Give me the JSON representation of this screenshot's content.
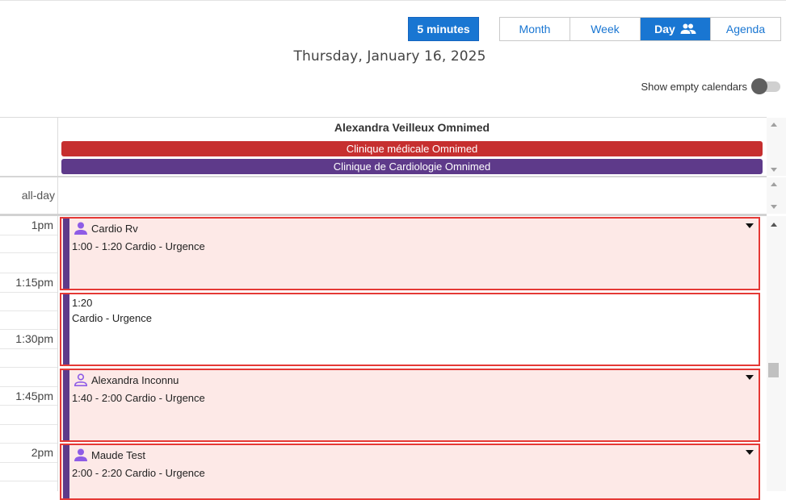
{
  "toolbar": {
    "interval_label": "5 minutes",
    "views": [
      {
        "label": "Month",
        "active": false
      },
      {
        "label": "Week",
        "active": false
      },
      {
        "label": "Day",
        "active": true
      },
      {
        "label": "Agenda",
        "active": false
      }
    ]
  },
  "date_title": "Thursday, January 16, 2025",
  "show_empty": {
    "label": "Show empty calendars",
    "enabled": false
  },
  "resource": {
    "name": "Alexandra Veilleux Omnimed",
    "calendars": [
      {
        "label": "Clinique médicale Omnimed",
        "color": "#c62f2f"
      },
      {
        "label": "Clinique de Cardiologie Omnimed",
        "color": "#5e3a8a"
      }
    ]
  },
  "allday_label": "all-day",
  "time_labels": [
    "1pm",
    "1:15pm",
    "1:30pm",
    "1:45pm",
    "2pm"
  ],
  "events": [
    {
      "patient": "Cardio Rv",
      "detail": "1:00 - 1:20 Cardio - Urgence",
      "icon": "person-filled-icon",
      "style": "pink"
    },
    {
      "time": "1:20",
      "detail": "Cardio - Urgence",
      "style": "white"
    },
    {
      "patient": "Alexandra Inconnu",
      "detail": "1:40 - 2:00 Cardio - Urgence",
      "icon": "person-outline-icon",
      "style": "pink"
    },
    {
      "patient": "Maude Test",
      "detail": "2:00 - 2:20 Cardio - Urgence",
      "icon": "person-filled-icon",
      "style": "pink"
    }
  ],
  "colors": {
    "accent": "#1976d2",
    "event_border": "#e53935",
    "event_bg": "#fde9e7",
    "calendar_stripe": "#5e3a8a"
  }
}
